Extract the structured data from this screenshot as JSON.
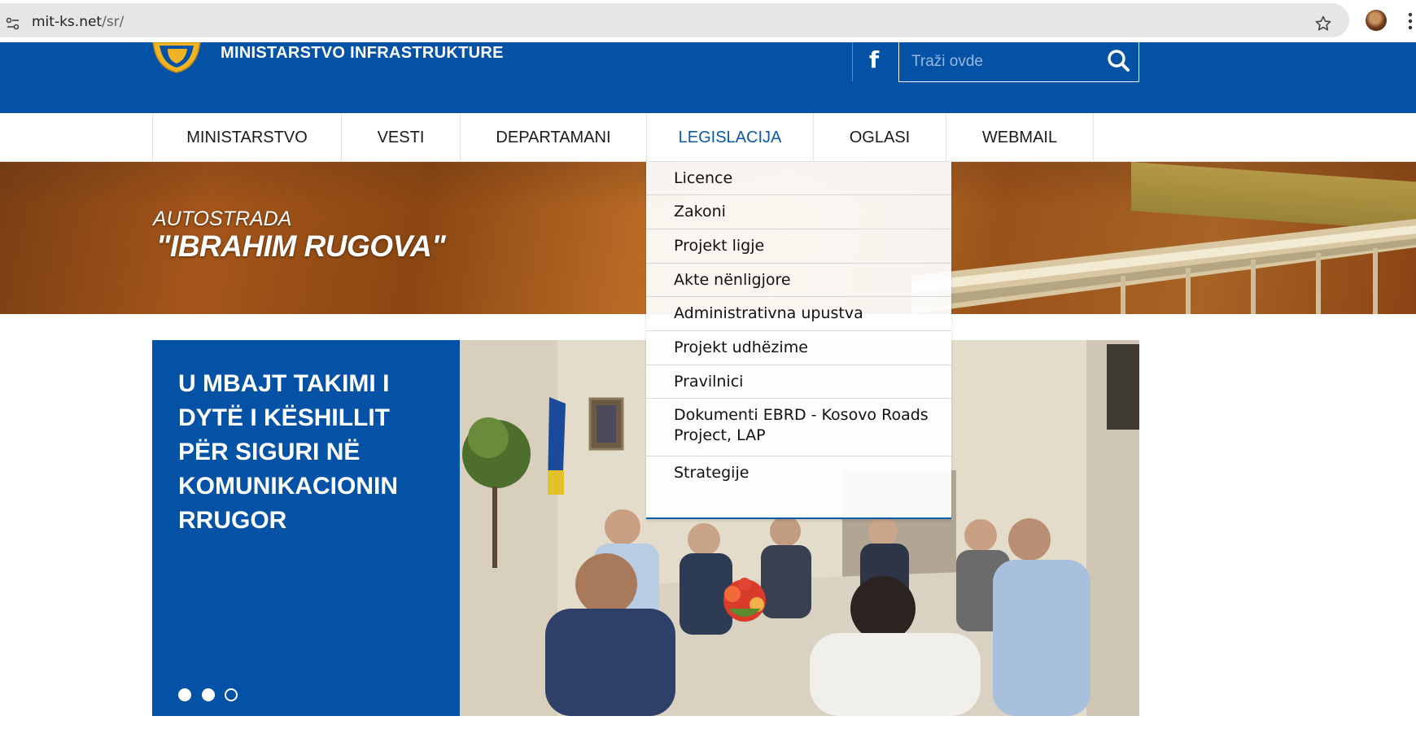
{
  "browser": {
    "url_host": "mit-ks.net",
    "url_path": "/sr/",
    "icons": [
      "site-info-icon",
      "bookmark-star-icon",
      "profile-avatar",
      "more-menu-icon"
    ]
  },
  "header": {
    "ministry_name": "MINISTARSTVO INFRASTRUKTURE",
    "search_placeholder": "Traži ovde",
    "facebook_icon_glyph": "f",
    "brand_color": "#0452a6"
  },
  "nav": {
    "items": [
      {
        "label": "MINISTARSTVO"
      },
      {
        "label": "VESTI"
      },
      {
        "label": "DEPARTAMANI"
      },
      {
        "label": "LEGISLACIJA",
        "active": true
      },
      {
        "label": "OGLASI"
      },
      {
        "label": "WEBMAIL"
      }
    ],
    "active_color": "#0b5aa8"
  },
  "hero": {
    "caption_line1": "AUTOSTRADA",
    "caption_line2": "\"IBRAHIM RUGOVA\""
  },
  "dropdown": {
    "items": [
      {
        "label": "Licence"
      },
      {
        "label": "Zakoni"
      },
      {
        "label": "Projekt ligje"
      },
      {
        "label": "Akte nënligjore"
      },
      {
        "label": "Administrativna upustva"
      },
      {
        "label": "Projekt udhëzime"
      },
      {
        "label": "Pravilnici"
      },
      {
        "label": "Dokumenti EBRD - Kosovo Roads Project, LAP"
      },
      {
        "label": "Strategije"
      }
    ]
  },
  "slider": {
    "title": "U MBAJT TAKIMI I DYTË I KËSHILLIT PËR SIGURI NË KOMUNIKACIONIN RRUGOR",
    "dots": [
      "filled",
      "filled",
      "hollow"
    ]
  }
}
